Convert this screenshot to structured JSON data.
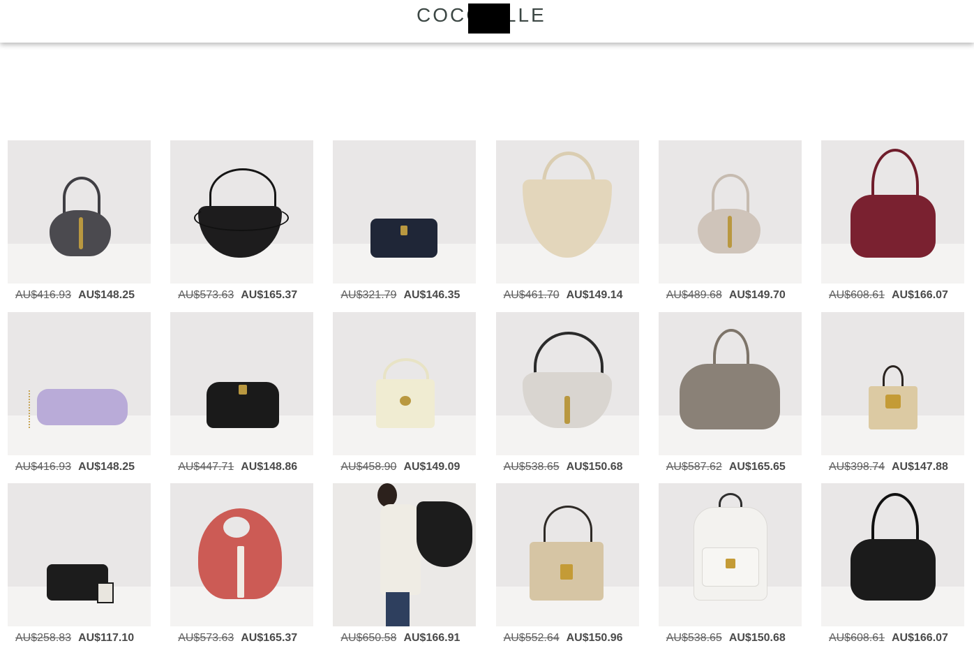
{
  "header": {
    "logo": "COCC ELLE"
  },
  "products": [
    {
      "old_price": "AU$416.93",
      "price": "AU$148.25",
      "name": "bag-charcoal-flap-icon",
      "color": "#4b4a4f"
    },
    {
      "old_price": "AU$573.63",
      "price": "AU$165.37",
      "name": "bag-black-hobo-icon",
      "color": "#1d1c1d"
    },
    {
      "old_price": "AU$321.79",
      "price": "AU$146.35",
      "name": "bag-navy-camera-icon",
      "color": "#1f2637"
    },
    {
      "old_price": "AU$461.70",
      "price": "AU$149.14",
      "name": "bag-beige-crescent-icon",
      "color": "#e3d6bb"
    },
    {
      "old_price": "AU$489.68",
      "price": "AU$149.70",
      "name": "bag-taupe-flap-icon",
      "color": "#cfc4ba"
    },
    {
      "old_price": "AU$608.61",
      "price": "AU$166.07",
      "name": "bag-burgundy-tote-icon",
      "color": "#7a2130"
    },
    {
      "old_price": "AU$416.93",
      "price": "AU$148.25",
      "name": "bag-lilac-pleated-clutch-icon",
      "color": "#b9abd8"
    },
    {
      "old_price": "AU$447.71",
      "price": "AU$148.86",
      "name": "bag-black-pouch-icon",
      "color": "#1a1a1a"
    },
    {
      "old_price": "AU$458.90",
      "price": "AU$149.09",
      "name": "bag-cream-flap-icon",
      "color": "#f0ecd2"
    },
    {
      "old_price": "AU$538.65",
      "price": "AU$150.68",
      "name": "bag-grey-saddle-icon",
      "color": "#d9d5d0"
    },
    {
      "old_price": "AU$587.62",
      "price": "AU$165.65",
      "name": "bag-taupe-tote-icon",
      "color": "#8a8177"
    },
    {
      "old_price": "AU$398.74",
      "price": "AU$147.88",
      "name": "bag-sand-mini-icon",
      "color": "#dccaa3"
    },
    {
      "old_price": "AU$258.83",
      "price": "AU$117.10",
      "name": "bag-black-camera-icon",
      "color": "#1c1c1c"
    },
    {
      "old_price": "AU$573.63",
      "price": "AU$165.37",
      "name": "bag-coral-round-icon",
      "color": "#cc5b55"
    },
    {
      "old_price": "AU$650.58",
      "price": "AU$166.91",
      "name": "model-with-black-bag-icon",
      "color": "#1c1c1c"
    },
    {
      "old_price": "AU$552.64",
      "price": "AU$150.96",
      "name": "bag-beige-satchel-icon",
      "color": "#d6c5a4"
    },
    {
      "old_price": "AU$538.65",
      "price": "AU$150.68",
      "name": "bag-white-backpack-icon",
      "color": "#f3f2ef"
    },
    {
      "old_price": "AU$608.61",
      "price": "AU$166.07",
      "name": "bag-black-tote-icon",
      "color": "#1b1b1b"
    }
  ]
}
